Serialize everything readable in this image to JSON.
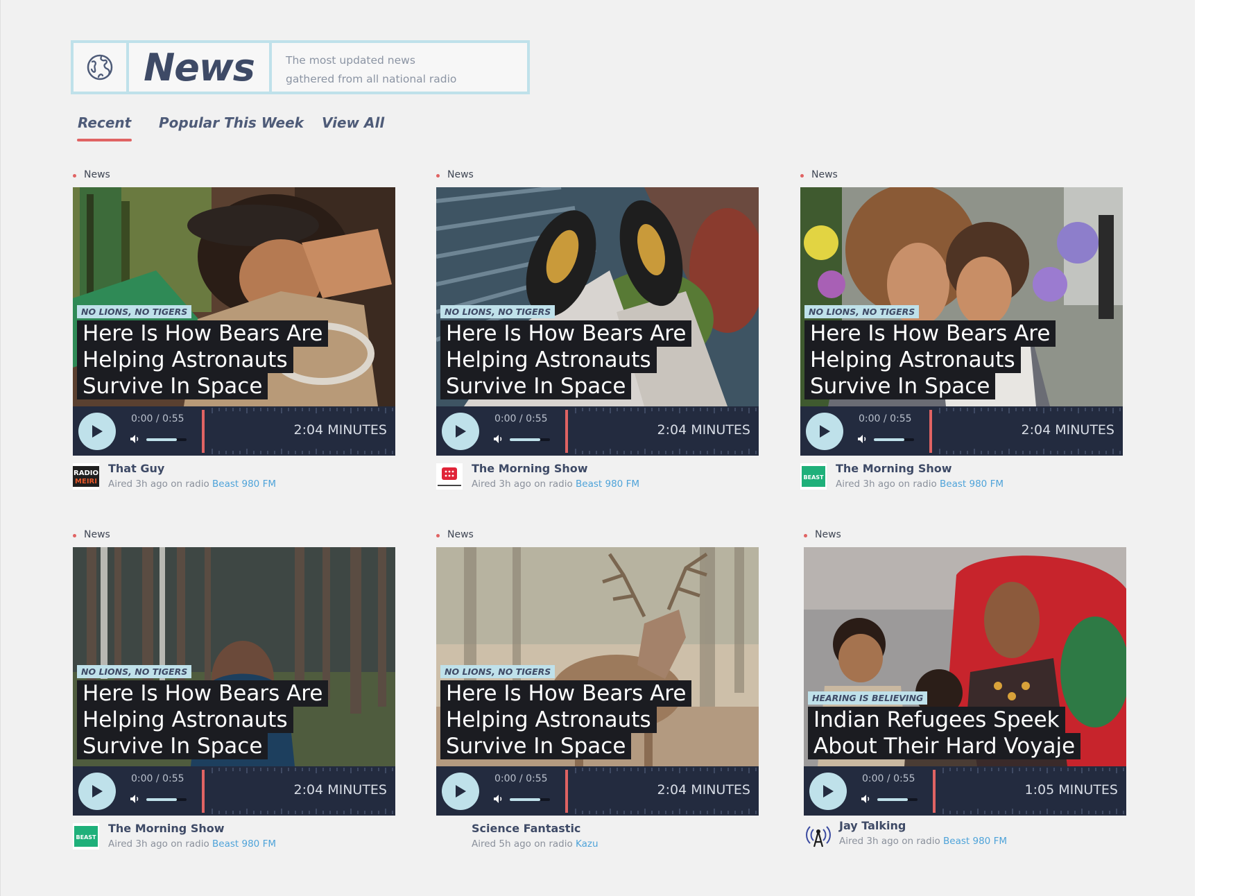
{
  "header": {
    "title": "News",
    "subtitle_line1": "The most updated news",
    "subtitle_line2": "gathered from all national radio",
    "icon": "globe-icon"
  },
  "tabs": [
    {
      "label": "Recent",
      "active": true
    },
    {
      "label": "Popular This Week",
      "active": false
    },
    {
      "label": "View All",
      "active": false
    }
  ],
  "colors": {
    "accent_red": "#e06363",
    "light_blue": "#bfe1ea",
    "navy": "#3e4a66",
    "player_bg": "#232b3f",
    "link_blue": "#4ea3d9"
  },
  "cards": [
    {
      "category": "News",
      "tag": "NO LIONS, NO TIGERS",
      "headline": [
        "Here Is How Bears Are",
        "Helping Astronauts",
        "Survive In Space"
      ],
      "current_time": "0:00",
      "total_time": "0:55",
      "duration": "2:04 MINUTES",
      "show": "That Guy",
      "aired_prefix": "Aired 3h ago on radio ",
      "station": "Beast 980 FM",
      "logo": "radio-meiri-logo",
      "volume": 0.75
    },
    {
      "category": "News",
      "tag": "NO LIONS, NO TIGERS",
      "headline": [
        "Here Is How Bears Are",
        "Helping Astronauts",
        "Survive In Space"
      ],
      "current_time": "0:00",
      "total_time": "0:55",
      "duration": "2:04 MINUTES",
      "show": "The Morning Show",
      "aired_prefix": "Aired 3h ago on radio ",
      "station": "Beast 980 FM",
      "logo": "red-radio-logo",
      "volume": 0.75
    },
    {
      "category": "News",
      "tag": "NO LIONS, NO TIGERS",
      "headline": [
        "Here Is How Bears Are",
        "Helping Astronauts",
        "Survive In Space"
      ],
      "current_time": "0:00",
      "total_time": "0:55",
      "duration": "2:04 MINUTES",
      "show": "The Morning Show",
      "aired_prefix": "Aired 3h ago on radio ",
      "station": "Beast 980 FM",
      "logo": "beast-green-logo",
      "volume": 0.75
    },
    {
      "category": "News",
      "tag": "NO LIONS, NO TIGERS",
      "headline": [
        "Here Is How Bears Are",
        "Helping Astronauts",
        "Survive In Space"
      ],
      "current_time": "0:00",
      "total_time": "0:55",
      "duration": "2:04 MINUTES",
      "show": "The Morning Show",
      "aired_prefix": "Aired 3h ago on radio ",
      "station": "Beast 980 FM",
      "logo": "beast-green-logo",
      "volume": 0.75
    },
    {
      "category": "News",
      "tag": "NO LIONS, NO TIGERS",
      "headline": [
        "Here Is How Bears Are",
        "Helping Astronauts",
        "Survive In Space"
      ],
      "current_time": "0:00",
      "total_time": "0:55",
      "duration": "2:04 MINUTES",
      "show": "Science Fantastic",
      "aired_prefix": "Aired 5h ago on radio ",
      "station": "Kazu",
      "logo": "none",
      "volume": 0.75
    },
    {
      "category": "News",
      "tag": "HEARING IS BELIEVING",
      "headline": [
        "Indian Refugees Speek",
        "About Their Hard Voyaje"
      ],
      "current_time": "0:00",
      "total_time": "0:55",
      "duration": "1:05 MINUTES",
      "show": "Jay Talking",
      "aired_prefix": "Aired 3h ago on radio ",
      "station": "Beast 980 FM",
      "logo": "antenna-logo",
      "volume": 0.75
    }
  ]
}
